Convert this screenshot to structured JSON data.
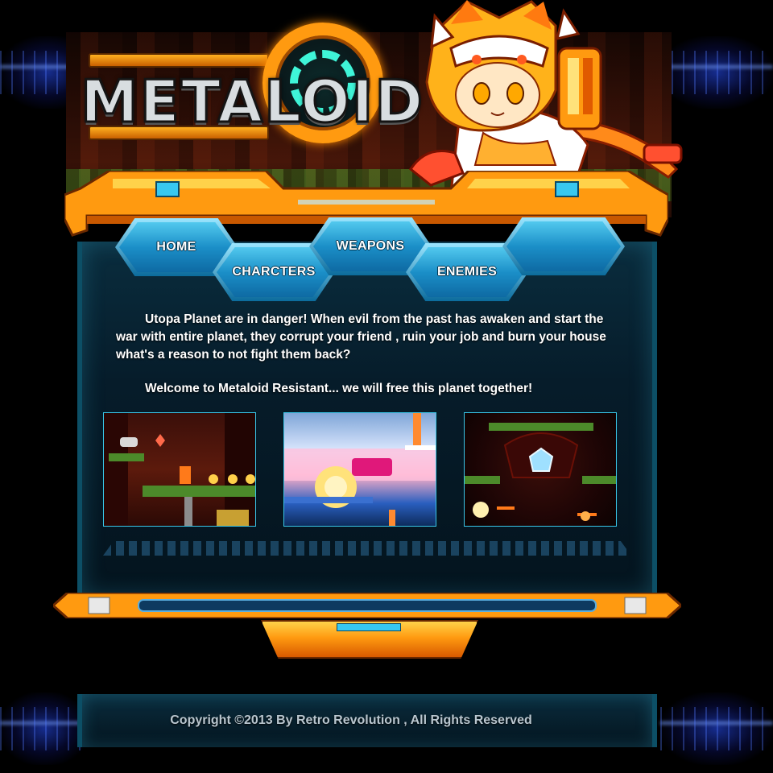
{
  "brand": {
    "logo_text": "METALOID"
  },
  "nav": {
    "items": [
      {
        "label": "HOME"
      },
      {
        "label": "CHARCTERS"
      },
      {
        "label": "WEAPONS"
      },
      {
        "label": "ENEMIES"
      },
      {
        "label": ""
      }
    ]
  },
  "main": {
    "intro_paragraph": "Utopa Planet are in danger! When evil from the past has awaken and start the war with entire planet, they corrupt your friend , ruin your job and burn your house what's a reason to not fight them back?",
    "welcome": "Welcome to Metaloid Resistant... we will free this planet together!",
    "screenshots": [
      {
        "name": "gameplay-screenshot-jungle"
      },
      {
        "name": "gameplay-screenshot-boss-blast"
      },
      {
        "name": "gameplay-screenshot-cavern"
      }
    ]
  },
  "footer": {
    "copyright": "Copyright ©2013 By Retro Revolution ,  All Rights Reserved"
  },
  "colors": {
    "frame_orange": "#ff9a10",
    "panel_blue": "#0a2d3e",
    "nav_blue": "#1b8fc8",
    "glow_blue": "#2850ff"
  }
}
